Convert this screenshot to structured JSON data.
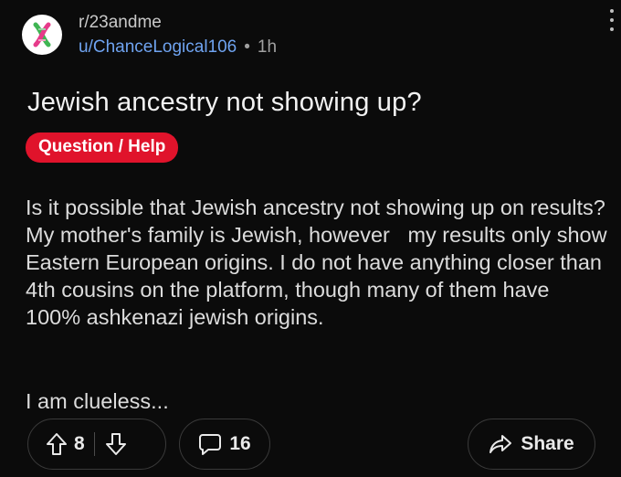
{
  "post": {
    "subreddit": "r/23andme",
    "username": "u/ChanceLogical106",
    "separator": "•",
    "time": "1h",
    "title": "Jewish ancestry not showing up?",
    "flair": "Question / Help",
    "body_paragraph_1": "Is it possible that Jewish ancestry not showing up on results? My mother's family is Jewish, however   my results only show Eastern European origins. I do not have anything closer than 4th cousins on the platform, though many of them have 100% ashkenazi jewish origins.",
    "body_paragraph_2": "I am clueless..."
  },
  "actions": {
    "vote_count": "8",
    "comment_count": "16",
    "share_label": "Share"
  },
  "icons": {
    "avatar": "23andme-logo-icon",
    "more": "more-icon",
    "upvote": "upvote-arrow-icon",
    "downvote": "downvote-arrow-icon",
    "comment": "comment-bubble-icon",
    "share": "share-arrow-icon"
  },
  "colors": {
    "background": "#0b0b0b",
    "username": "#6fa3f0",
    "flair_background": "#e0132b",
    "logo_green": "#3fb553",
    "logo_pink": "#e63b8a"
  }
}
